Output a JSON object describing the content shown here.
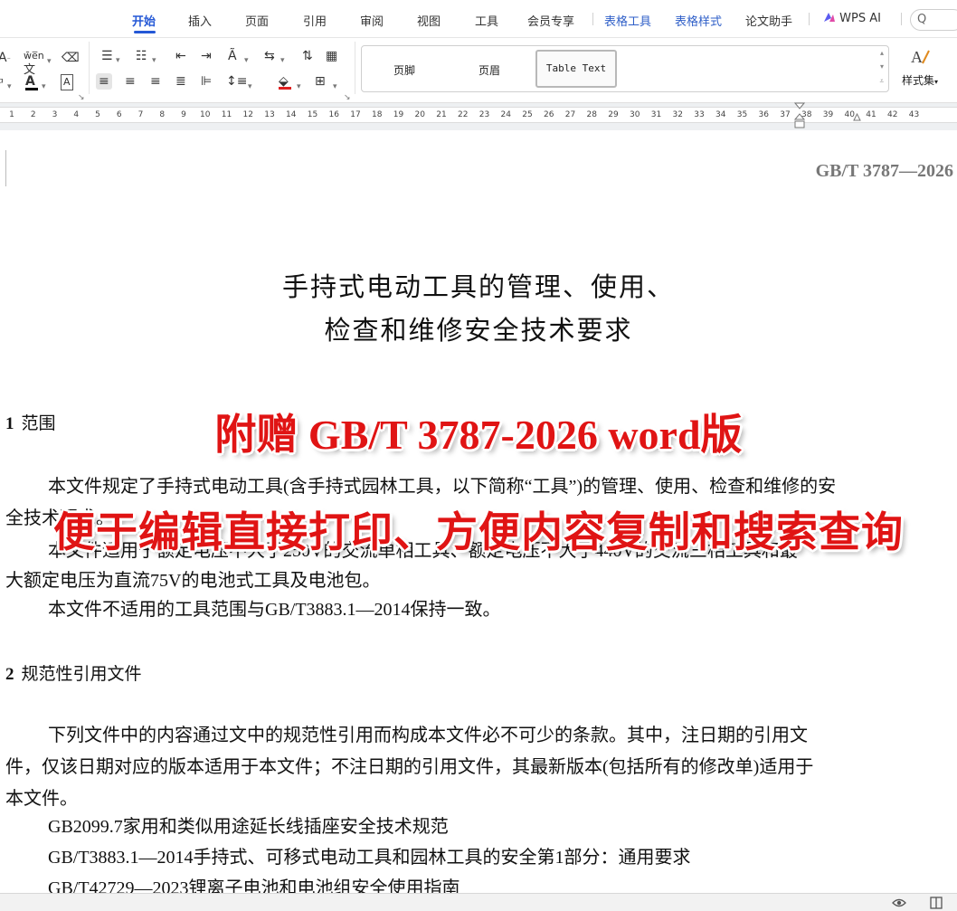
{
  "menu": {
    "tabs": [
      "开始",
      "插入",
      "页面",
      "引用",
      "审阅",
      "视图",
      "工具",
      "会员专享",
      "表格工具",
      "表格样式",
      "论文助手",
      "WPS AI"
    ],
    "search_placeholder": "Q"
  },
  "ribbon": {
    "styles": {
      "footer": "页脚",
      "header": "页眉",
      "table_text": "Table Text"
    },
    "styles_set_label": "样式集",
    "font_color_hex": "#000000",
    "highlight_color_hex": "#e02020"
  },
  "ruler": {
    "ticks": [
      "1",
      "2",
      "3",
      "4",
      "5",
      "6",
      "7",
      "8",
      "9",
      "10",
      "11",
      "12",
      "13",
      "14",
      "15",
      "16",
      "17",
      "18",
      "19",
      "20",
      "21",
      "22",
      "23",
      "24",
      "25",
      "26",
      "27",
      "28",
      "29",
      "30",
      "31",
      "32",
      "33",
      "34",
      "35",
      "36",
      "37",
      "38",
      "39",
      "40",
      "41",
      "42",
      "43"
    ]
  },
  "document": {
    "header_right": "GB/T 3787—2026",
    "title_line1": "手持式电动工具的管理、使用、",
    "title_line2": "检查和维修安全技术要求",
    "section1": {
      "number": "1",
      "title": "范围",
      "paragraphs": [
        "本文件规定了手持式电动工具(含手持式园林工具，以下简称“工具”)的管理、使用、检查和维修的安",
        "全技术要求。",
        "本文件适用于额定电压不大于250V的交流单相工具、额定电压不大于440V的交流三相工具和最",
        "大额定电压为直流75V的电池式工具及电池包。",
        "本文件不适用的工具范围与GB/T3883.1—2014保持一致。"
      ]
    },
    "section2": {
      "number": "2",
      "title": "规范性引用文件",
      "paragraphs": [
        "下列文件中的内容通过文中的规范性引用而构成本文件必不可少的条款。其中，注日期的引用文",
        "件，仅该日期对应的版本适用于本文件；不注日期的引用文件，其最新版本(包括所有的修改单)适用于",
        "本文件。",
        "GB2099.7家用和类似用途延长线插座安全技术规范",
        "GB/T3883.1—2014手持式、可移式电动工具和园林工具的安全第1部分：通用要求",
        "GB/T42729—2023锂离子电池和电池组安全使用指南"
      ]
    }
  },
  "promo": {
    "line1": "附赠 GB/T 3787-2026 word版",
    "line2": "便于编辑直接打印、方便内容复制和搜索查询",
    "color": "#e01414"
  }
}
